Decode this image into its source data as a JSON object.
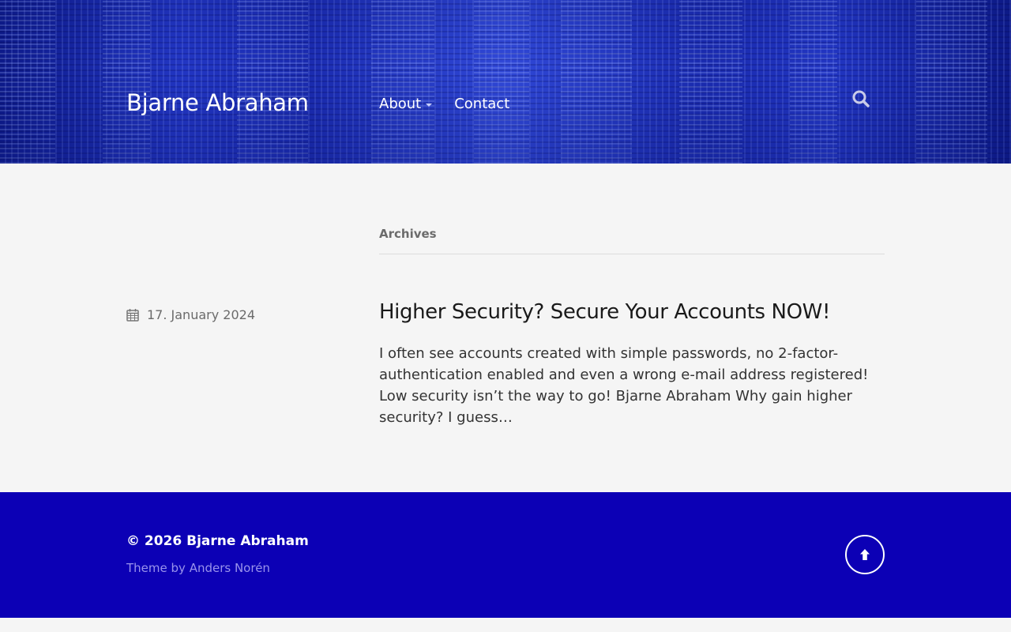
{
  "header": {
    "site_title": "Bjarne Abraham",
    "nav": [
      {
        "label": "About",
        "has_dropdown": true
      },
      {
        "label": "Contact",
        "has_dropdown": false
      }
    ],
    "search_icon": "search-icon"
  },
  "main": {
    "archive_label": "Archives",
    "post": {
      "date_icon": "calendar-icon",
      "date": "17. January 2024",
      "title": "Higher Security? Secure Your Accounts NOW!",
      "excerpt": "I often see accounts created with simple passwords, no 2-factor-authentication enabled and even a wrong e-mail address registered! Low security isn’t the way to go! Bjarne Abraham Why gain higher security? I guess…"
    }
  },
  "footer": {
    "copyright": "© 2026 Bjarne Abraham",
    "credit_prefix": "Theme by",
    "credit_link": "Anders Norén",
    "to_top_icon": "arrow-up-icon"
  },
  "colors": {
    "header_blue": "#2236c4",
    "footer_blue": "#0c00b5",
    "page_bg": "#f5f5f5"
  }
}
